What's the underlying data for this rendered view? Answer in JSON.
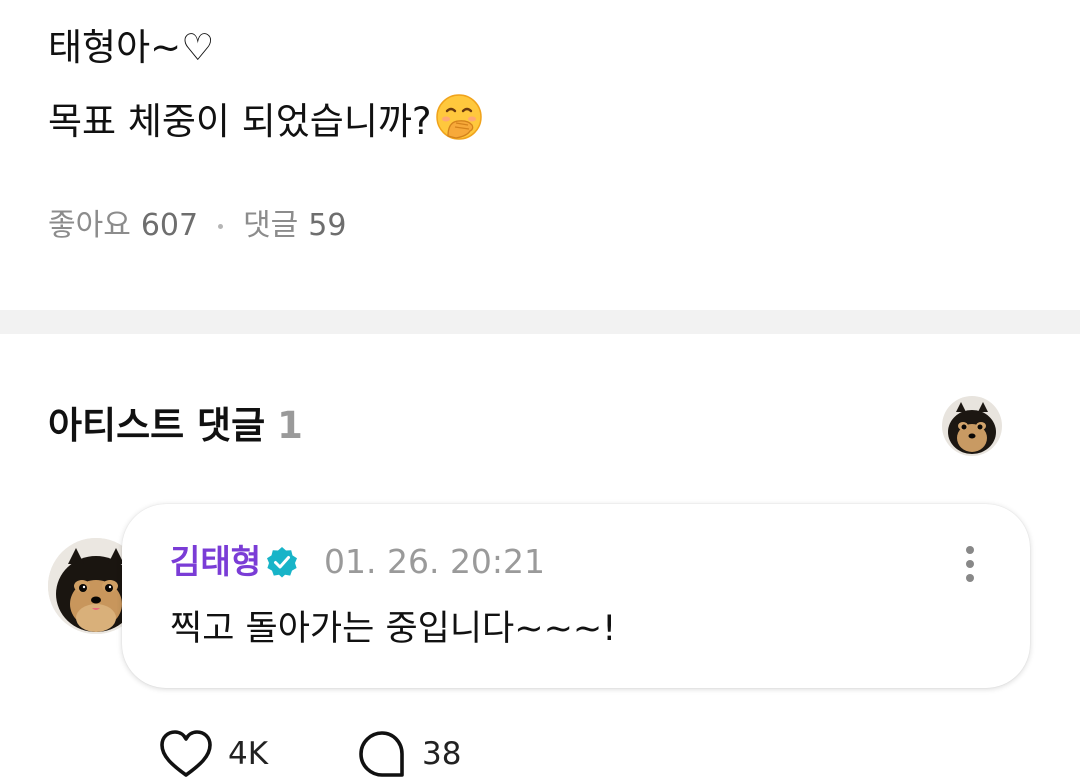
{
  "post": {
    "line1": "태형아~♡",
    "line2": "목표 체중이 되었습니까?",
    "emoji": "hand-over-mouth-emoji",
    "likes_label": "좋아요",
    "likes_count": "607",
    "comments_label": "댓글",
    "comments_count": "59"
  },
  "artist_section": {
    "title": "아티스트 댓글",
    "count": "1",
    "avatar": "pomeranian-dog-avatar"
  },
  "comment": {
    "author": "김태형",
    "verified_icon": "verified-badge-icon",
    "timestamp": "01. 26. 20:21",
    "text": "찍고 돌아가는 중입니다~~~!",
    "more_icon": "more-vertical-icon",
    "like_icon": "heart-icon",
    "like_count": "4K",
    "reply_icon": "speech-bubble-icon",
    "reply_count": "38"
  },
  "colors": {
    "author": "#7a3cd6",
    "verified": "#18b4c8",
    "muted": "#8c8c8c",
    "divider": "#f2f2f2"
  }
}
